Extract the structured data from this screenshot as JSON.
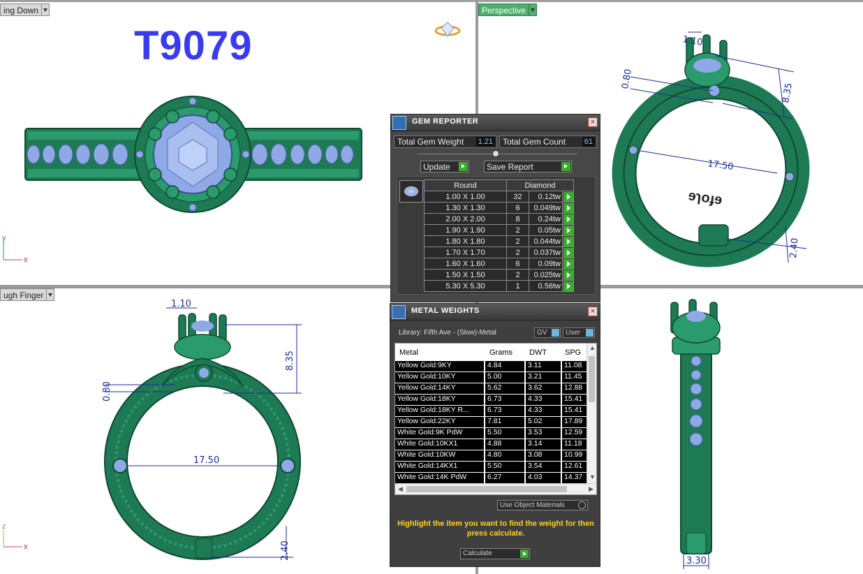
{
  "viewports": {
    "top_left": {
      "label": "ing Down"
    },
    "top_right": {
      "label": "Perspective"
    },
    "bottom_left": {
      "label": "ugh Finger"
    }
  },
  "model_code": "T9079",
  "dimensions": {
    "prong": "1.10",
    "head_height": "8.35",
    "gallery": "0.80",
    "inner_diameter": "17.50",
    "shank": "2.40",
    "width": "3.30",
    "engraving": "ɘɿoɟɘ"
  },
  "axes": {
    "y": "y",
    "x": "x",
    "z": "z"
  },
  "gem_reporter": {
    "title": "GEM REPORTER",
    "total_weight_label": "Total Gem Weight",
    "total_weight": "1.21",
    "total_count_label": "Total Gem Count",
    "total_count": "61",
    "update_label": "Update",
    "save_label": "Save Report",
    "col_shape": "Round",
    "col_type": "Diamond",
    "rows": [
      {
        "size": "1.00 X 1.00",
        "count": "32",
        "weight": "0.12tw"
      },
      {
        "size": "1.30 X 1.30",
        "count": "6",
        "weight": "0.049tw"
      },
      {
        "size": "2.00 X 2.00",
        "count": "8",
        "weight": "0.24tw"
      },
      {
        "size": "1.90 X 1.90",
        "count": "2",
        "weight": "0.05tw"
      },
      {
        "size": "1.80 X 1.80",
        "count": "2",
        "weight": "0.044tw"
      },
      {
        "size": "1.70 X 1.70",
        "count": "2",
        "weight": "0.037tw"
      },
      {
        "size": "1.60 X 1.60",
        "count": "6",
        "weight": "0.09tw"
      },
      {
        "size": "1.50 X 1.50",
        "count": "2",
        "weight": "0.025tw"
      },
      {
        "size": "5.30 X 5.30",
        "count": "1",
        "weight": "0.56tw"
      }
    ]
  },
  "metal_weights": {
    "title": "METAL WEIGHTS",
    "library": "Library: Fifth Ave - (Slow)-Metal",
    "gv_label": "GV",
    "user_label": "User",
    "headers": {
      "metal": "Metal",
      "grams": "Grams",
      "dwt": "DWT",
      "spg": "SPG"
    },
    "rows": [
      {
        "metal": "Yellow Gold:9KY",
        "grams": "4.84",
        "dwt": "3.11",
        "spg": "11.08"
      },
      {
        "metal": "Yellow Gold:10KY",
        "grams": "5.00",
        "dwt": "3.21",
        "spg": "11.45"
      },
      {
        "metal": "Yellow Gold:14KY",
        "grams": "5.62",
        "dwt": "3.62",
        "spg": "12.88"
      },
      {
        "metal": "Yellow Gold:18KY",
        "grams": "6.73",
        "dwt": "4.33",
        "spg": "15.41"
      },
      {
        "metal": "Yellow Gold:18KY R...",
        "grams": "6.73",
        "dwt": "4.33",
        "spg": "15.41"
      },
      {
        "metal": "Yellow Gold:22KY",
        "grams": "7.81",
        "dwt": "5.02",
        "spg": "17.89"
      },
      {
        "metal": "White Gold:9K PdW",
        "grams": "5.50",
        "dwt": "3.53",
        "spg": "12.59"
      },
      {
        "metal": "White Gold:10KX1",
        "grams": "4.88",
        "dwt": "3.14",
        "spg": "11.18"
      },
      {
        "metal": "White Gold:10KW",
        "grams": "4.80",
        "dwt": "3.08",
        "spg": "10.99"
      },
      {
        "metal": "White Gold:14KX1",
        "grams": "5.50",
        "dwt": "3.54",
        "spg": "12.61"
      },
      {
        "metal": "White Gold:14K PdW",
        "grams": "6.27",
        "dwt": "4.03",
        "spg": "14.37"
      }
    ],
    "use_object_materials": "Use Object Materials",
    "hint": "Highlight the item you want to find the weight for then press calculate.",
    "calculate_label": "Calculate"
  },
  "colors": {
    "metal_green": "#1e7a55",
    "gem_blue": "#8fa9e6",
    "dimension_blue": "#1d2a9a",
    "title_blue": "#3a3af0",
    "hint_yellow": "#ffd21a"
  }
}
